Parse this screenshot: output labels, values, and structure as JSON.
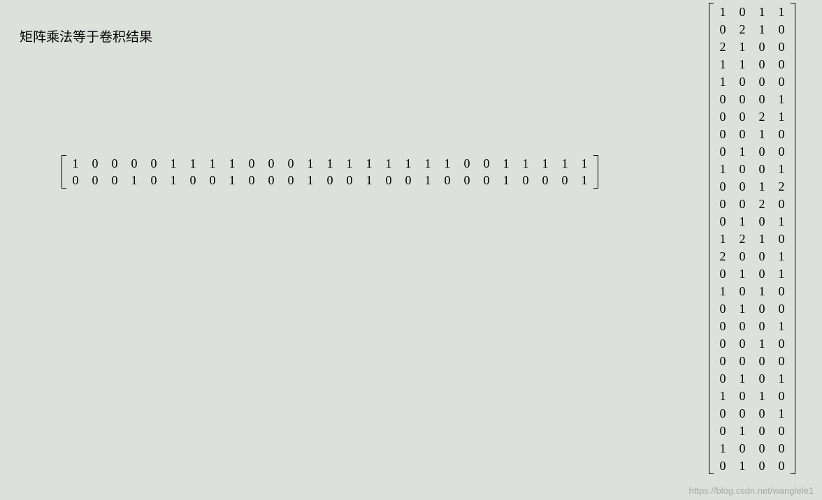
{
  "title": "矩阵乘法等于卷积结果",
  "matrixA": [
    [
      1,
      0,
      0,
      0,
      0,
      1,
      1,
      1,
      1,
      0,
      0,
      0,
      1,
      1,
      1,
      1,
      1,
      1,
      1,
      1,
      0,
      0,
      1,
      1,
      1,
      1,
      1
    ],
    [
      0,
      0,
      0,
      1,
      0,
      1,
      0,
      0,
      1,
      0,
      0,
      0,
      1,
      0,
      0,
      1,
      0,
      0,
      1,
      0,
      0,
      0,
      1,
      0,
      0,
      0,
      1
    ]
  ],
  "matrixB": [
    [
      1,
      0,
      1,
      1
    ],
    [
      0,
      2,
      1,
      0
    ],
    [
      2,
      1,
      0,
      0
    ],
    [
      1,
      1,
      0,
      0
    ],
    [
      1,
      0,
      0,
      0
    ],
    [
      0,
      0,
      0,
      1
    ],
    [
      0,
      0,
      2,
      1
    ],
    [
      0,
      0,
      1,
      0
    ],
    [
      0,
      1,
      0,
      0
    ],
    [
      1,
      0,
      0,
      1
    ],
    [
      0,
      0,
      1,
      2
    ],
    [
      0,
      0,
      2,
      0
    ],
    [
      0,
      1,
      0,
      1
    ],
    [
      1,
      2,
      1,
      0
    ],
    [
      2,
      0,
      0,
      1
    ],
    [
      0,
      1,
      0,
      1
    ],
    [
      1,
      0,
      1,
      0
    ],
    [
      0,
      1,
      0,
      0
    ],
    [
      0,
      0,
      0,
      1
    ],
    [
      0,
      0,
      1,
      0
    ],
    [
      0,
      0,
      0,
      0
    ],
    [
      0,
      1,
      0,
      1
    ],
    [
      1,
      0,
      1,
      0
    ],
    [
      0,
      0,
      0,
      1
    ],
    [
      0,
      1,
      0,
      0
    ],
    [
      1,
      0,
      0,
      0
    ],
    [
      0,
      1,
      0,
      0
    ]
  ],
  "watermark": "https://blog.csdn.net/wanglele1"
}
